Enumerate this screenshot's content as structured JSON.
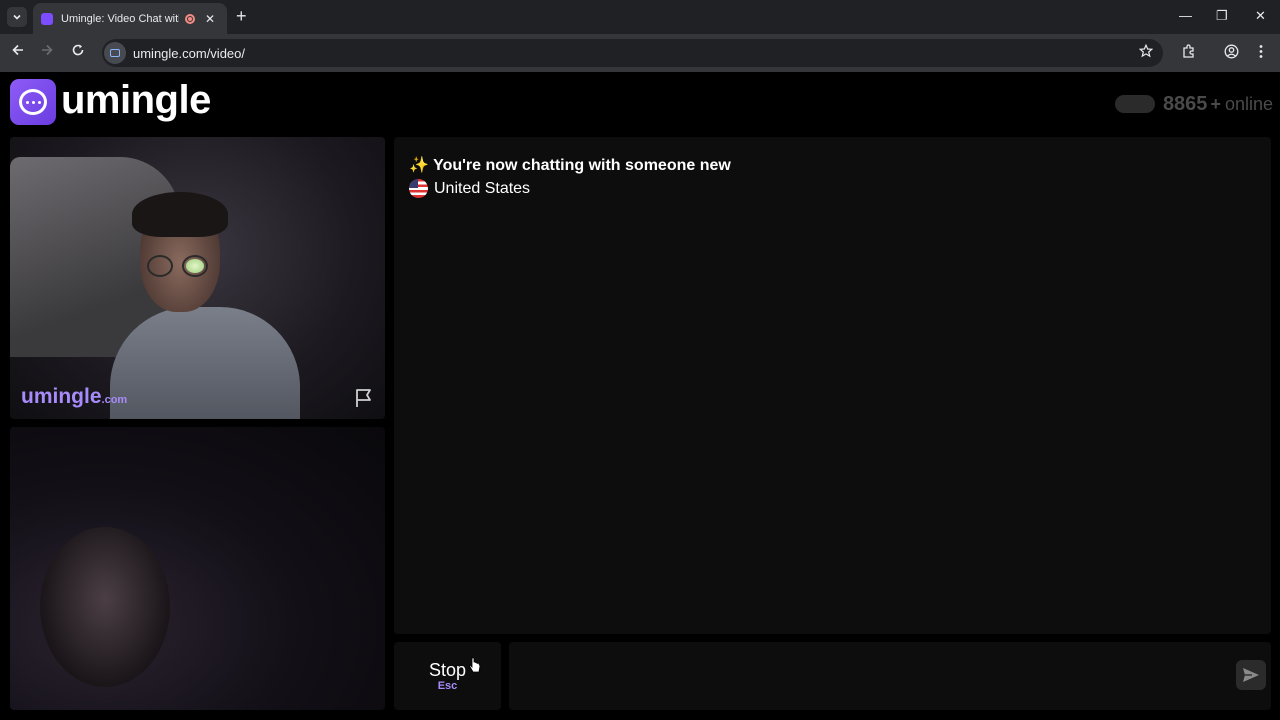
{
  "browser": {
    "tab_title": "Umingle: Video Chat with St",
    "url": "umingle.com/video/",
    "new_tab_label": "+",
    "close_tab_label": "✕",
    "minimize_label": "—",
    "restore_label": "❐",
    "close_window_label": "✕"
  },
  "header": {
    "logo_text": "umingle",
    "online_count": "8865",
    "online_plus": "+",
    "online_label": "online"
  },
  "remote_video": {
    "watermark": "umingle",
    "watermark_suffix": ".com"
  },
  "chat": {
    "sparkle": "✨",
    "status_message": "You're now chatting with someone new",
    "country": "United States"
  },
  "controls": {
    "stop_label": "Stop",
    "stop_shortcut": "Esc",
    "message_placeholder": ""
  },
  "colors": {
    "accent": "#a78bfa",
    "logo": "#7c4dff"
  }
}
